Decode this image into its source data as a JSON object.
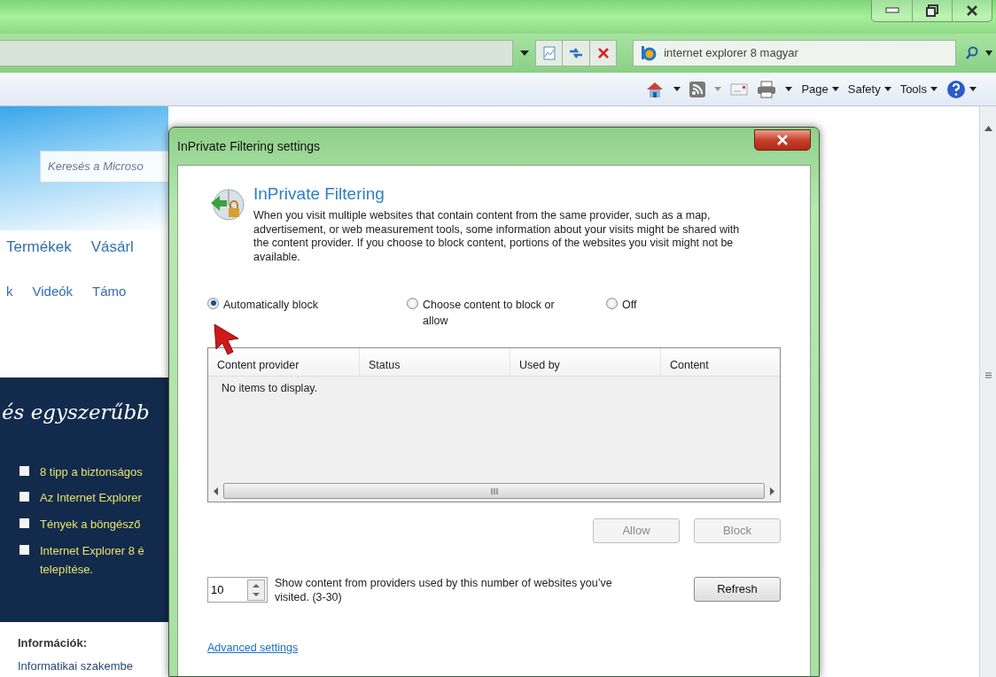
{
  "browser": {
    "search": {
      "value": "internet explorer 8 magyar"
    },
    "command_menus": [
      "Page",
      "Safety",
      "Tools"
    ]
  },
  "page": {
    "search": {
      "placeholder": "Keresés a Microso"
    },
    "nav": [
      "Termékek",
      "Vásárl"
    ],
    "subnav": [
      "k",
      "Videók",
      "Támo"
    ],
    "banner": {
      "heading": "és egyszerűbb",
      "links": [
        "8 tipp a biztonságos",
        "Az Internet Explorer",
        "Tények a böngésző",
        "Internet Explorer 8 é\ntelepítése."
      ]
    },
    "info": {
      "heading": "Információk:",
      "links": [
        "Informatikai szakembe"
      ]
    }
  },
  "dialog": {
    "title": "InPrivate Filtering settings",
    "heading": "InPrivate Filtering",
    "description": "When you visit multiple websites that contain content from the same provider, such as a map, advertisement, or web measurement tools, some information about your visits might be shared with the content provider. If you choose to block content, portions of the websites you visit might not be available.",
    "options": [
      {
        "label": "Automatically block",
        "selected": true
      },
      {
        "label": "Choose content to block or allow",
        "selected": false
      },
      {
        "label": "Off",
        "selected": false
      }
    ],
    "table": {
      "columns": [
        "Content provider",
        "Status",
        "Used by",
        "Content"
      ],
      "empty_text": "No items to display."
    },
    "buttons": [
      {
        "label": "Allow",
        "disabled": true
      },
      {
        "label": "Block",
        "disabled": true
      }
    ],
    "threshold": {
      "value": "10",
      "label": "Show content from providers used by this number of websites you’ve visited. (3-30)"
    },
    "refresh_button": {
      "label": "Refresh",
      "disabled": false
    },
    "advanced_link": "Advanced settings"
  }
}
